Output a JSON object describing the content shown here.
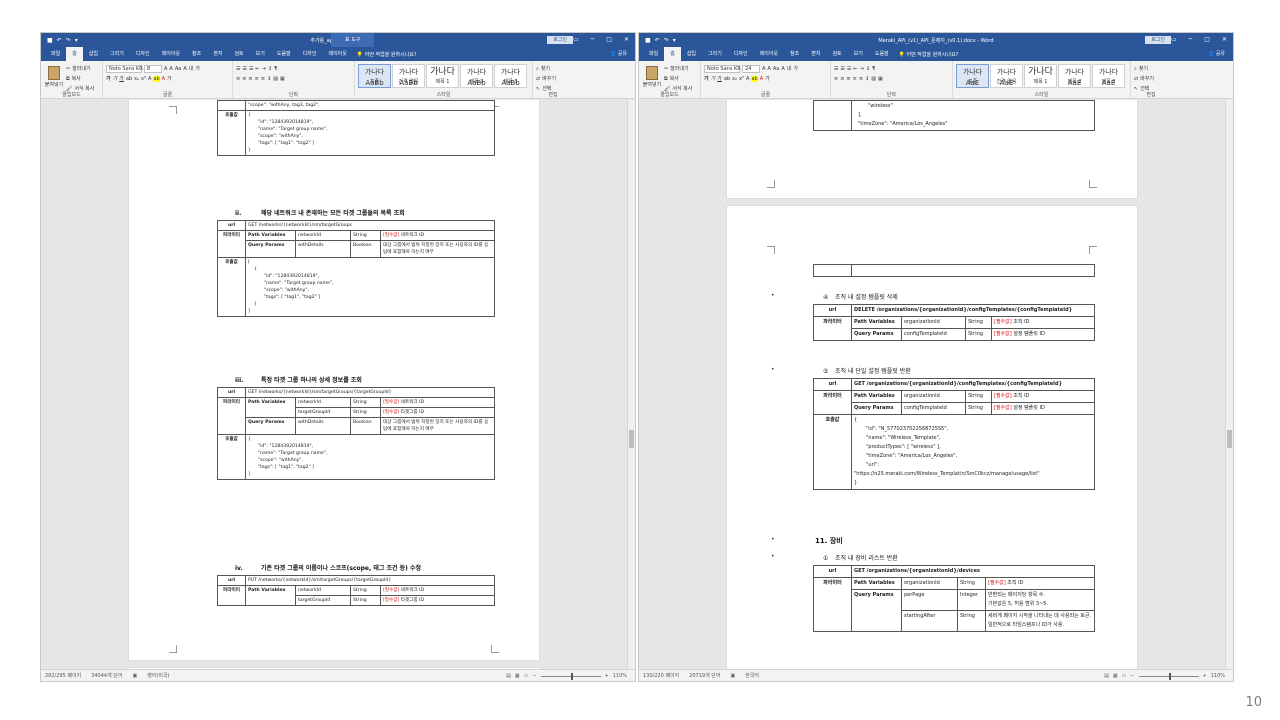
{
  "slide": {
    "page_number": "10"
  },
  "left": {
    "titlebar": {
      "title": "추가용_api.docx - Word",
      "context_tab": "표 도구",
      "login": "로그인"
    },
    "tabs": [
      "파일",
      "홈",
      "삽입",
      "그리기",
      "디자인",
      "레이아웃",
      "참조",
      "편지",
      "검토",
      "보기",
      "도움말",
      "디자인",
      "레이아웃"
    ],
    "tell_me": "어떤 작업을 원하시나요?",
    "share": "공유",
    "ribbon": {
      "paste": "붙여넣기",
      "cut": "잘라내기",
      "copy": "복사",
      "format_painter": "서식 복사",
      "font_name": "Noto Sans KR",
      "font_size": "8",
      "groups": [
        "클립보드",
        "글꼴",
        "단락",
        "스타일",
        "편집"
      ],
      "styles": [
        {
          "sample": "가나다AaBb",
          "name": "표준"
        },
        {
          "sample": "가나다AaBb",
          "name": "간격 없음"
        },
        {
          "sample": "가나다",
          "name": "제목 1"
        },
        {
          "sample": "가나다AaBb",
          "name": "제목 2"
        },
        {
          "sample": "가나다AaBb",
          "name": "제목 3"
        }
      ],
      "find": "찾기",
      "replace": "바꾸기",
      "select": "선택"
    },
    "status": {
      "page": "282/295 페이지",
      "words": "34044개 단어",
      "lang": "영어(미국)",
      "zoom": "110%"
    },
    "doc": {
      "top_table": {
        "scope_line": "\"scope\": \"withAny, tag3, tag2\",",
        "response_label": "호출값",
        "response_lines": [
          "{",
          "\"id\": \"1284392014819\",",
          "\"name\": \"Target group name\",",
          "\"scope\": \"withAny\",",
          "\"tags\": [ \"tag1\", \"tag2\" ]",
          "}"
        ]
      },
      "sec_ii": {
        "num": "ii.",
        "title": "해당 네트워크 내 존재하는 모든 타겟 그룹들의 목록 조회",
        "url_label": "url",
        "url": "GET /networks/{networkId}/sm/targetGroups",
        "param_label": "파라미터",
        "path_vars": "Path Variables",
        "p1_name": "networkId",
        "p1_type": "String",
        "p1_req": "[필수값]",
        "p1_desc": "네트워크 ID",
        "query_params": "Query Params",
        "q1_name": "withDetails",
        "q1_type": "Boolean",
        "q1_desc": "대상 그룹에서 범위 지정된 장치 또는 사용자의 ID를 응답에 포함해야 하는지 여부",
        "response_label": "호출값",
        "response_lines": [
          "[",
          "{",
          "\"id\": \"1284392014819\",",
          "\"name\": \"Target group name\",",
          "\"scope\": \"withAny\",",
          "\"tags\": [ \"tag1\", \"tag2\" ]",
          "}",
          "]"
        ]
      },
      "sec_iii": {
        "num": "iii.",
        "title": "특정 타겟 그룹 하나의 상세 정보를 조회",
        "url_label": "url",
        "url": "GET /networks/{networkId}/sm/targetGroups/{targetGroupId}",
        "param_label": "파라미터",
        "path_vars": "Path Variables",
        "p1_name": "networkId",
        "p1_type": "String",
        "p1_req": "[필수값]",
        "p1_desc": "네트워크 ID",
        "p2_name": "targetGroupId",
        "p2_type": "String",
        "p2_req": "[필수값]",
        "p2_desc": "타겟그룹 ID",
        "query_params": "Query Params",
        "q1_name": "withDetails",
        "q1_type": "Boolean",
        "q1_desc": "대상 그룹에서 범위 지정된 장치 또는 사용자의 ID를 응답에 포함해야 하는지 여부",
        "response_label": "호출값",
        "response_lines": [
          "{",
          "\"id\": \"1284392014819\",",
          "\"name\": \"Target group name\",",
          "\"scope\": \"withAny\",",
          "\"tags\": [ \"tag1\", \"tag2\" ]",
          "}"
        ]
      },
      "sec_iv": {
        "num": "iv.",
        "title": "기존 타겟 그룹의 이름이나 스코프(scope, 태그 조건 등) 수정",
        "url_label": "url",
        "url": "PUT /networks/{networkId}/sm/targetGroups/{targetGroupId}",
        "param_label": "파라미터",
        "path_vars": "Path Variables",
        "p1_name": "networkId",
        "p1_type": "String",
        "p1_req": "[필수값]",
        "p1_desc": "네트워크 ID",
        "p2_name": "targetGroupId",
        "p2_type": "String",
        "p2_req": "[필수값]",
        "p2_desc": "타겟그룹 ID"
      }
    }
  },
  "right": {
    "titlebar": {
      "title": "Meraki_API_(v1)_API_문제지_(v0.1).docx - Word",
      "login": "로그인"
    },
    "tabs": [
      "파일",
      "홈",
      "삽입",
      "그리기",
      "디자인",
      "레이아웃",
      "참조",
      "편지",
      "검토",
      "보기",
      "도움말"
    ],
    "tell_me": "어떤 작업을 원하시나요?",
    "share": "공유",
    "ribbon": {
      "paste": "붙여넣기",
      "cut": "잘라내기",
      "copy": "복사",
      "format_painter": "서식 복사",
      "font_name": "Noto Sans KR",
      "font_size": "24",
      "groups": [
        "클립보드",
        "글꼴",
        "단락",
        "스타일",
        "편집"
      ],
      "styles": [
        {
          "sample": "가나다AaE",
          "name": "표준"
        },
        {
          "sample": "가나다AaE",
          "name": "간격 없음"
        },
        {
          "sample": "가나다",
          "name": "제목 1"
        },
        {
          "sample": "가나다AaE",
          "name": "제목 2"
        },
        {
          "sample": "가나다AaE",
          "name": "제목 3"
        }
      ],
      "find": "찾기",
      "replace": "바꾸기",
      "select": "선택"
    },
    "status": {
      "page": "130/220 페이지",
      "words": "20719개 단어",
      "lang": "한국어",
      "zoom": "110%"
    },
    "doc": {
      "top_lines": [
        "\"wireless\"",
        "],",
        "\"timeZone\": \"America/Los_Angeles\""
      ],
      "sec4": {
        "num": "④",
        "title": "조직 내 설정 템플릿 삭제",
        "url_label": "url",
        "url": "DELETE /organizations/{organizationId}/configTemplates/{configTemplateId}",
        "param_label": "파라미터",
        "path_vars": "Path Variables",
        "p1_name": "organizationId",
        "p1_type": "String",
        "p1_req": "[필수값]",
        "p1_desc": "조직 ID",
        "query_params": "Query Params",
        "q1_name": "configTemplateId",
        "q1_type": "String",
        "q1_req": "[필수값]",
        "q1_desc": "설정 템플릿 ID"
      },
      "sec5": {
        "num": "⑤",
        "title": "조직 내 단일 설정 템플릿 반환",
        "url_label": "url",
        "url": "GET /organizations/{organizationId}/configTemplates/{configTemplateId}",
        "param_label": "파라미터",
        "path_vars": "Path Variables",
        "p1_name": "organizationId",
        "p1_type": "String",
        "p1_req": "[필수값]",
        "p1_desc": "조직 ID",
        "query_params": "Query Params",
        "q1_name": "configTemplateId",
        "q1_type": "String",
        "q1_req": "[필수값]",
        "q1_desc": "설정 템플릿 ID",
        "response_label": "호출값",
        "response_lines": [
          "{",
          "\"id\": \"N_5770237022568725S5\",",
          "\"name\": \"Wireless_Template\",",
          "\"productTypes\": [ \"wireless\" ],",
          "\"timeZone\": \"America/Los_Angeles\",",
          "\"url\":",
          "\"https://n25.meraki.com/Wireless_Templat/n/SmC0kcz/manage/usage/list\"",
          "}"
        ]
      },
      "sec11": {
        "title": "11. 장비",
        "sub_num": "①",
        "sub_title": "조직 내 장비 리스트 반환",
        "url_label": "url",
        "url": "GET /organizations/{organizationId}/devices",
        "param_label": "파라미터",
        "path_vars": "Path Variables",
        "p1_name": "organizationId",
        "p1_type": "String",
        "p1_req": "[필수값]",
        "p1_desc": "조직 ID",
        "query_params": "Query Params",
        "q1_name": "perPage",
        "q1_type": "Integer",
        "q1_desc": "반환되는 페이지당 항목 수.",
        "q1_desc2": "기본값은 5, 허용 범위 3~5.",
        "q2_name": "startingAfter",
        "q2_type": "String",
        "q2_desc": "세비게 페이지 시작을 나타내는 데 사용되는 토큰.",
        "q2_desc2": "일반적으로 타임스탬프나 ID가 사용."
      }
    }
  }
}
